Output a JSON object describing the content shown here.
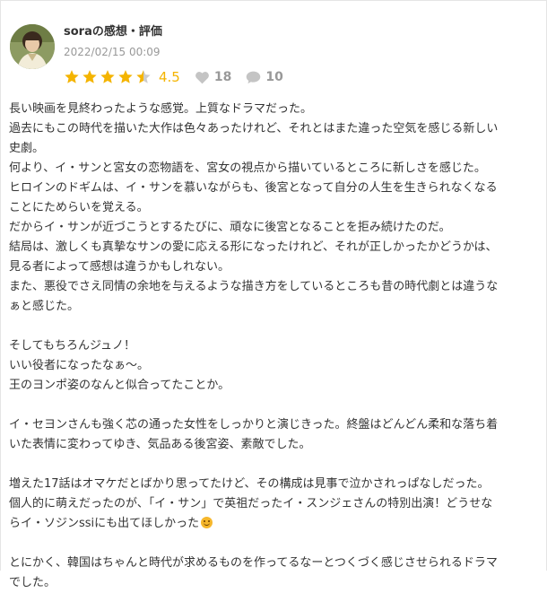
{
  "review": {
    "author_title": "soraの感想・評価",
    "date": "2022/02/15 00:09",
    "rating": 4.5,
    "rating_text": "4.5",
    "likes": "18",
    "comments": "10",
    "colors": {
      "star": "#f4b400",
      "star_empty": "#cccccc",
      "meta": "#999999"
    },
    "icons": {
      "like": "heart-icon",
      "comment": "speech-bubble-icon"
    }
  },
  "body": {
    "p1": [
      "長い映画を見終わったような感覚。上質なドラマだった。",
      "過去にもこの時代を描いた大作は色々あったけれど、それとはまた違った空気を感じる新しい",
      "史劇。",
      "何より、イ・サンと宮女の恋物語を、宮女の視点から描いているところに新しさを感じた。",
      "ヒロインのドギムは、イ・サンを慕いながらも、後宮となって自分の人生を生きられなくなる",
      "ことにためらいを覚える。",
      "だからイ・サンが近づこうとするたびに、頑なに後宮となることを拒み続けたのだ。",
      "結局は、激しくも真摯なサンの愛に応える形になったけれど、それが正しかったかどうかは、",
      "見る者によって感想は違うかもしれない。",
      "また、悪役でさえ同情の余地を与えるような描き方をしているところも昔の時代劇とは違うな",
      "ぁと感じた。"
    ],
    "p2": [
      "そしてもちろんジュノ！",
      "いい役者になったなぁ〜。",
      "王のヨンポ姿のなんと似合ってたことか。"
    ],
    "p3": [
      "イ・セヨンさんも強く芯の通った女性をしっかりと演じきった。終盤はどんどん柔和な落ち着",
      "いた表情に変わってゆき、気品ある後宮姿、素敵でした。"
    ],
    "p4": [
      "増えた17話はオマケだとばかり思ってたけど、その構成は見事で泣かされっぱなしだった。",
      "個人的に萌えだったのが、「イ・サン」で英祖だったイ・スンジェさんの特別出演！どうせな",
      "らイ・ソジンssiにも出てほしかった"
    ],
    "p4_emoji": "smiling-face-emoji",
    "p5": [
      "とにかく、韓国はちゃんと時代が求めるものを作ってるなーとつくづく感じさせられるドラマ",
      "でした。"
    ]
  }
}
